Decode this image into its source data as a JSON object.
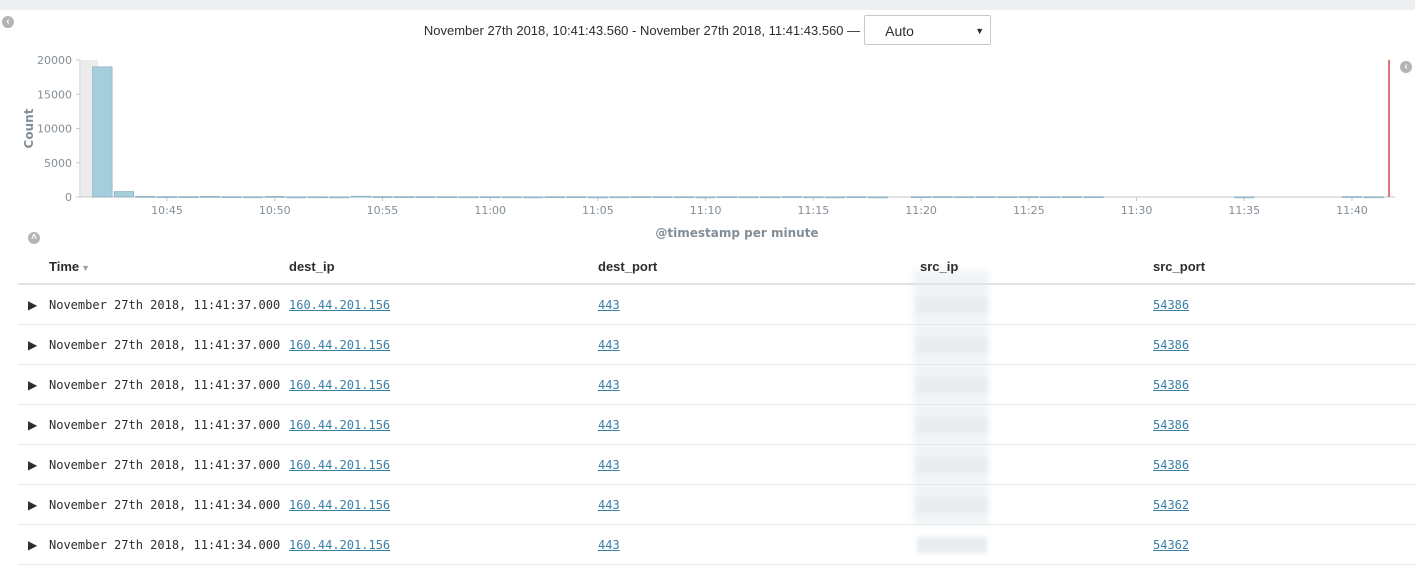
{
  "time_range": {
    "label": "November 27th 2018, 10:41:43.560 - November 27th 2018, 11:41:43.560 —",
    "interval": "Auto"
  },
  "icons": {
    "collapse_left": "chevron-left-circle-icon",
    "collapse_right": "chevron-left-circle-icon",
    "toggle_chart": "chevron-up-circle-icon",
    "expand_row": "caret-right-icon",
    "sort": "caret-down-icon"
  },
  "colors": {
    "bar": "#a6cddb",
    "bar_stroke": "#7ea9bb",
    "link": "#3a7fa6",
    "now_line": "#e07575"
  },
  "chart_data": {
    "type": "bar",
    "ylabel": "Count",
    "xlabel": "@timestamp per minute",
    "ylim": [
      0,
      20000
    ],
    "yticks": [
      "0",
      "5000",
      "10000",
      "15000",
      "20000"
    ],
    "xticks": [
      "10:45",
      "10:50",
      "10:55",
      "11:00",
      "11:05",
      "11:10",
      "11:15",
      "11:20",
      "11:25",
      "11:30",
      "11:35",
      "11:40"
    ],
    "series": [
      {
        "x": [
          "10:42",
          "10:43",
          "10:44",
          "10:45",
          "10:46",
          "10:47",
          "10:48",
          "10:49",
          "10:50",
          "10:51",
          "10:52",
          "10:53",
          "10:54",
          "10:55",
          "10:56",
          "10:57",
          "10:58",
          "10:59",
          "11:00",
          "11:01",
          "11:02",
          "11:03",
          "11:04",
          "11:05",
          "11:06",
          "11:07",
          "11:08",
          "11:09",
          "11:10",
          "11:11",
          "11:12",
          "11:13",
          "11:14",
          "11:15",
          "11:16",
          "11:17",
          "11:18",
          "11:19",
          "11:20",
          "11:21",
          "11:22",
          "11:23",
          "11:24",
          "11:25",
          "11:26",
          "11:27",
          "11:28",
          "11:29",
          "11:30",
          "11:31",
          "11:32",
          "11:33",
          "11:34",
          "11:35",
          "11:36",
          "11:37",
          "11:38",
          "11:39",
          "11:40",
          "11:41"
        ],
        "values": [
          19000,
          800,
          100,
          60,
          50,
          90,
          40,
          30,
          90,
          20,
          30,
          20,
          120,
          60,
          50,
          50,
          40,
          30,
          40,
          30,
          20,
          40,
          40,
          20,
          30,
          50,
          40,
          40,
          20,
          40,
          30,
          30,
          60,
          30,
          20,
          40,
          20,
          0,
          40,
          60,
          40,
          50,
          40,
          60,
          40,
          50,
          40,
          0,
          0,
          0,
          0,
          0,
          0,
          20,
          0,
          0,
          0,
          0,
          70,
          30
        ]
      }
    ]
  },
  "table": {
    "headers": {
      "time": "Time",
      "dest_ip": "dest_ip",
      "dest_port": "dest_port",
      "src_ip": "src_ip",
      "src_port": "src_port"
    },
    "rows": [
      {
        "time": "November 27th 2018, 11:41:37.000",
        "dest_ip": "160.44.201.156",
        "dest_port": "443",
        "src_port": "54386"
      },
      {
        "time": "November 27th 2018, 11:41:37.000",
        "dest_ip": "160.44.201.156",
        "dest_port": "443",
        "src_port": "54386"
      },
      {
        "time": "November 27th 2018, 11:41:37.000",
        "dest_ip": "160.44.201.156",
        "dest_port": "443",
        "src_port": "54386"
      },
      {
        "time": "November 27th 2018, 11:41:37.000",
        "dest_ip": "160.44.201.156",
        "dest_port": "443",
        "src_port": "54386"
      },
      {
        "time": "November 27th 2018, 11:41:37.000",
        "dest_ip": "160.44.201.156",
        "dest_port": "443",
        "src_port": "54386"
      },
      {
        "time": "November 27th 2018, 11:41:34.000",
        "dest_ip": "160.44.201.156",
        "dest_port": "443",
        "src_port": "54362"
      },
      {
        "time": "November 27th 2018, 11:41:34.000",
        "dest_ip": "160.44.201.156",
        "dest_port": "443",
        "src_port": "54362"
      }
    ]
  }
}
